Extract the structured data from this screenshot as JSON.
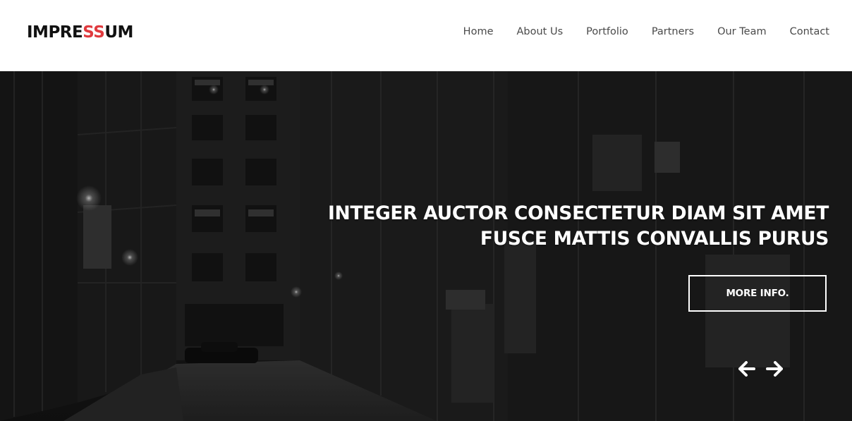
{
  "brand": {
    "prefix": "IMPRE",
    "accent": "SS",
    "suffix": "UM",
    "accent_color": "#e03a3e"
  },
  "nav": {
    "items": [
      {
        "label": "Home"
      },
      {
        "label": "About Us"
      },
      {
        "label": "Portfolio"
      },
      {
        "label": "Partners"
      },
      {
        "label": "Our Team"
      },
      {
        "label": "Contact"
      }
    ]
  },
  "hero": {
    "caption_line1": "INTEGER AUCTOR CONSECTETUR DIAM SIT AMET",
    "caption_line2": "FUSCE MATTIS CONVALLIS PURUS",
    "button_label": "MORE INFO.",
    "background": "dark-alley-photo",
    "prev_icon": "arrow-left-icon",
    "next_icon": "arrow-right-icon"
  }
}
